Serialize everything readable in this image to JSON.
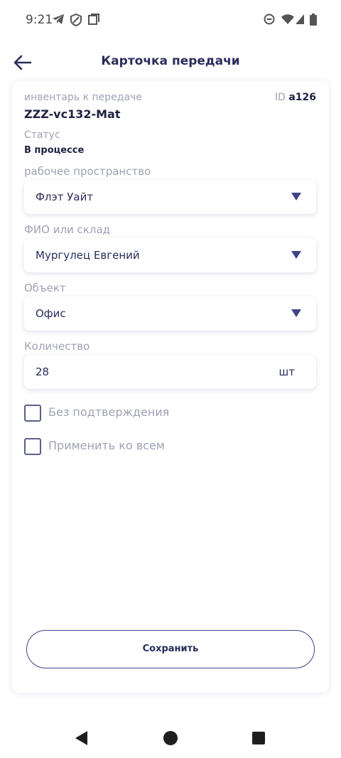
{
  "status_bar": {
    "time": "9:21",
    "left_icons": [
      "telegram-icon",
      "shield-icon",
      "screenshot-icon"
    ],
    "right_icons": [
      "dnd-icon",
      "wifi-icon",
      "signal-icon",
      "battery-icon"
    ]
  },
  "header": {
    "title": "Карточка передачи",
    "back_icon": "arrow-left-icon"
  },
  "card": {
    "inventory_label": "инвентарь к передаче",
    "inventory_name": "ZZZ-vc132-Mat",
    "id_label": "ID",
    "id_value": "a126",
    "status_label": "Статус",
    "status_value": "В процессе",
    "workspace": {
      "label": "рабочее пространство",
      "value": "Флэт Уайт"
    },
    "person": {
      "label": "ФИО или склад",
      "value": "Мургулец Евгений"
    },
    "object": {
      "label": "Объект",
      "value": "Офис"
    },
    "quantity": {
      "label": "Количество",
      "value": "28",
      "unit": "шт"
    },
    "checkboxes": [
      {
        "label": "Без подтверждения",
        "checked": false
      },
      {
        "label": "Применить ко всем",
        "checked": false
      }
    ],
    "save_label": "Сохранить"
  },
  "colors": {
    "accent": "#3f4387",
    "title_text": "#2b2d5c",
    "muted_label": "#9fa1b4"
  },
  "nav_bar": {
    "icons": [
      "nav-back-icon",
      "nav-home-icon",
      "nav-recents-icon"
    ]
  }
}
